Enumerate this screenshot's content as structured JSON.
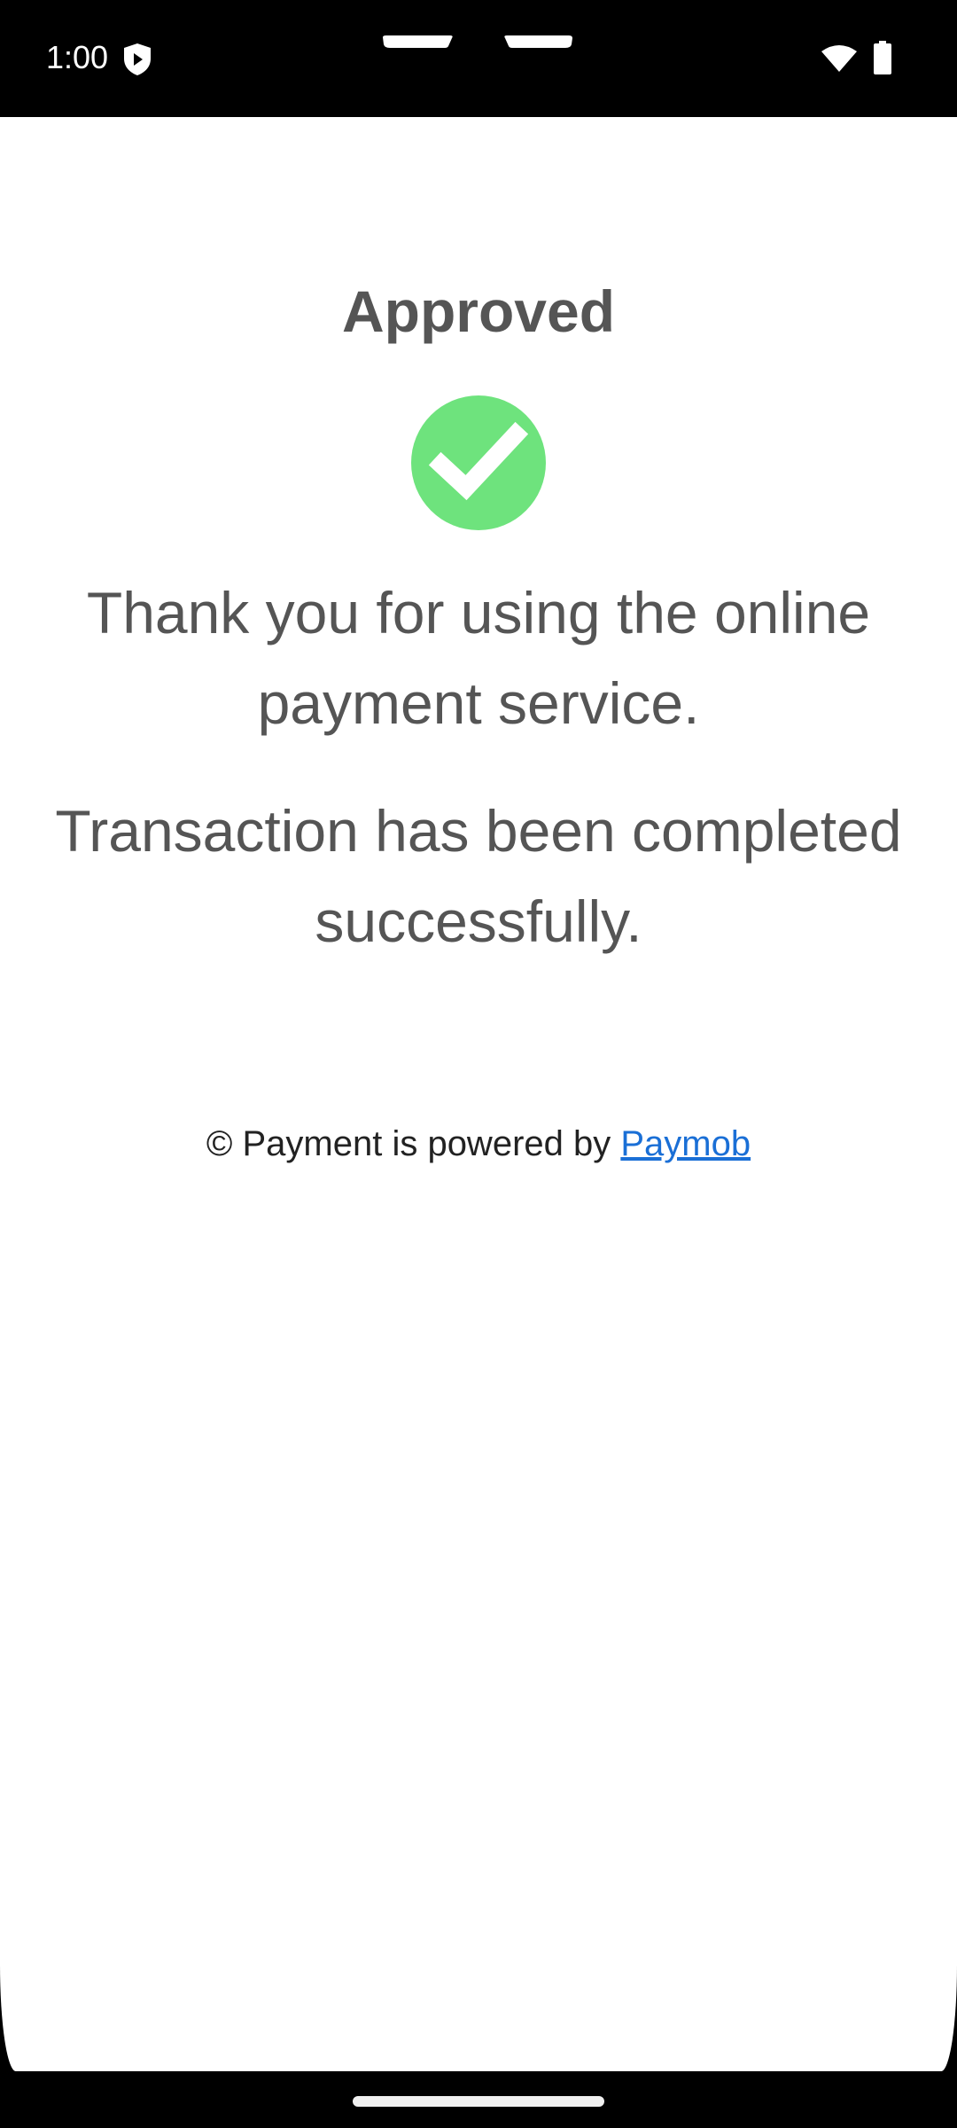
{
  "status_bar": {
    "time": "1:00",
    "icons": [
      "shield-icon",
      "wifi-icon",
      "battery-icon"
    ]
  },
  "page": {
    "title": "Approved",
    "status_icon": "check-circle-icon",
    "thank_you_message": "Thank you for using the online payment service.",
    "transaction_message": "Transaction has been completed successfully.",
    "footer": {
      "prefix": "© Payment is powered by ",
      "link_label": "Paymob"
    }
  },
  "colors": {
    "success_green": "#6ee37d",
    "text_gray": "#555555",
    "link_blue": "#1a6fd6"
  }
}
